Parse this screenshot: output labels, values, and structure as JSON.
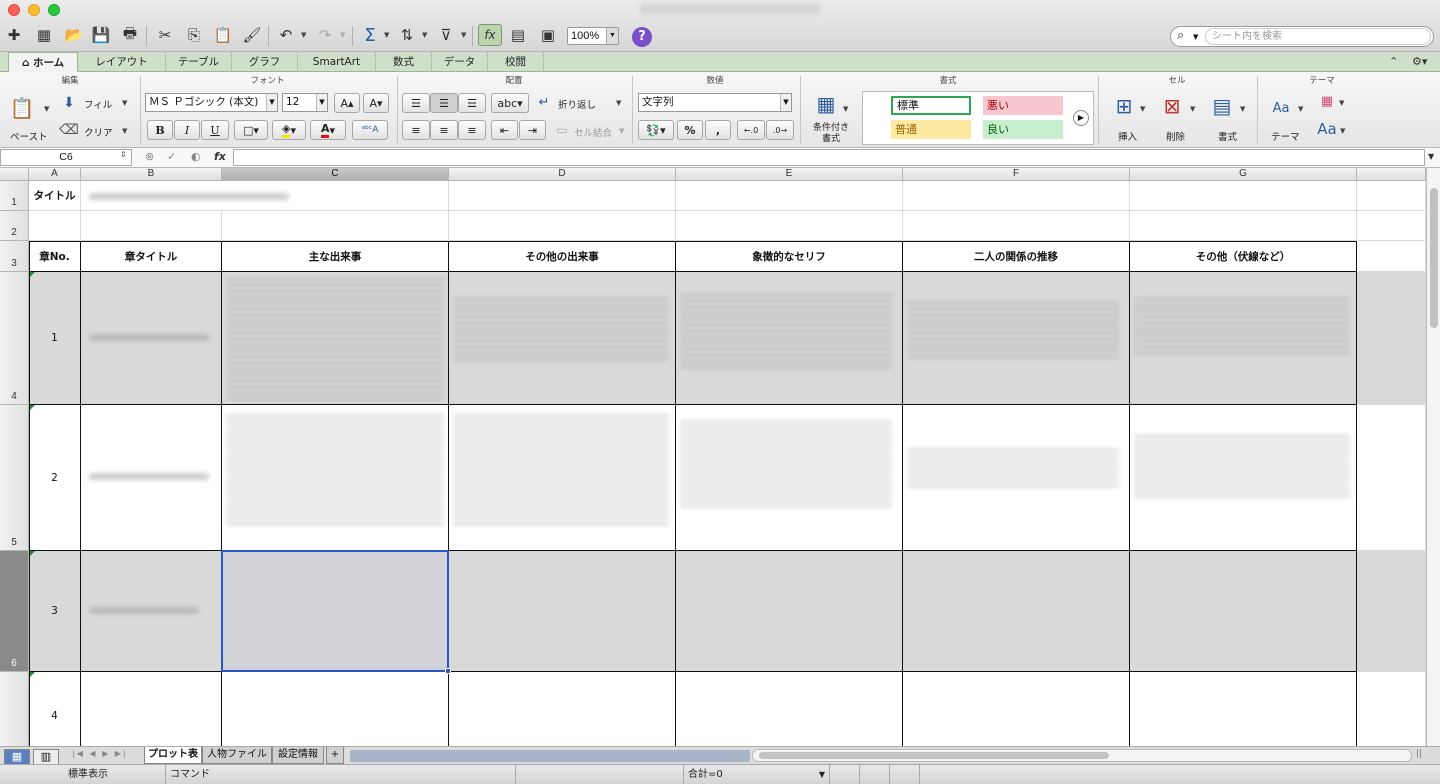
{
  "toolbar": {
    "zoom": "100%",
    "search_placeholder": "シート内を検索"
  },
  "ribbon_tabs": [
    "ホーム",
    "レイアウト",
    "テーブル",
    "グラフ",
    "SmartArt",
    "数式",
    "データ",
    "校閲"
  ],
  "ribbon": {
    "groups": {
      "edit": "編集",
      "font": "フォント",
      "alignment": "配置",
      "number": "数値",
      "format": "書式",
      "cells": "セル",
      "theme": "テーマ"
    },
    "paste": "ペースト",
    "fill": "フィル",
    "clear": "クリア",
    "font_name": "ＭＳ Ｐゴシック (本文)",
    "font_size": "12",
    "wrap": "折り返し",
    "merge": "セル結合",
    "number_format": "文字列",
    "cond_format": "条件付き書式",
    "styles": {
      "normal": "標準",
      "bad": "悪い",
      "neutral": "普通",
      "good": "良い"
    },
    "insert": "挿入",
    "delete": "削除",
    "format_btn": "書式",
    "theme": "テーマ",
    "bold": "B",
    "italic": "I",
    "underline": "U",
    "abc": "abc",
    "percent": "%",
    "comma": ",",
    "aa": "Aa"
  },
  "formula_bar": {
    "cell_ref": "C6",
    "fx": "fx"
  },
  "columns": [
    "A",
    "B",
    "C",
    "D",
    "E",
    "F",
    "G"
  ],
  "rows": [
    "1",
    "2",
    "3",
    "4",
    "5",
    "6"
  ],
  "sheet": {
    "title_label": "タイトル",
    "headers": [
      "章No.",
      "章タイトル",
      "主な出来事",
      "その他の出来事",
      "象徴的なセリフ",
      "二人の関係の推移",
      "その他（伏線など）"
    ],
    "chapter_numbers": [
      "1",
      "2",
      "3",
      "4"
    ]
  },
  "sheet_tabs": [
    "プロット表",
    "人物ファイル",
    "設定情報"
  ],
  "add_sheet": "+",
  "status": {
    "view": "標準表示",
    "mode": "コマンド",
    "sum": "合計=0"
  },
  "colors": {
    "ribbon_tab_bg": "#cfdfca",
    "selection_border": "#2b57c9",
    "bad_style": "#f7c6ce",
    "neutral_style": "#fdeaa0",
    "good_style": "#c7efcd"
  }
}
